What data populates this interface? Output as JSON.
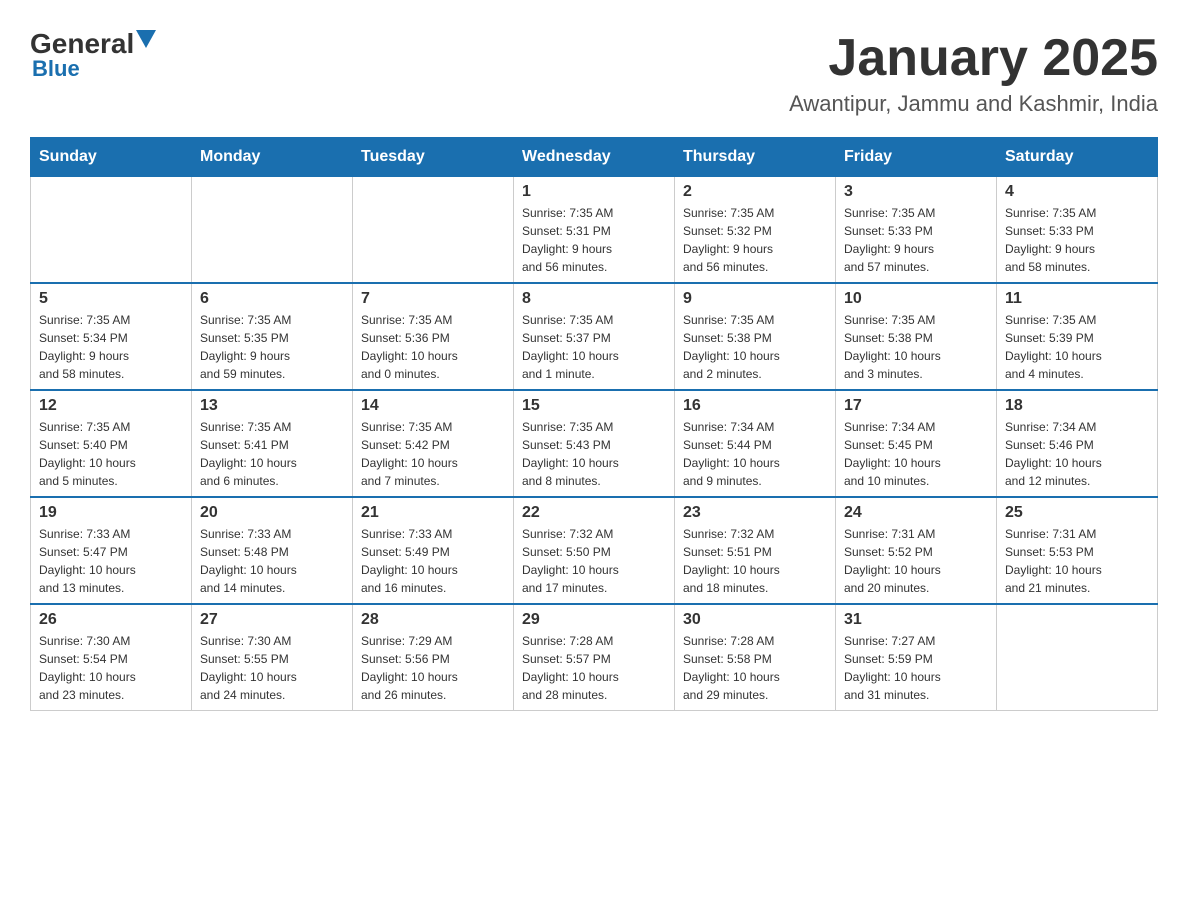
{
  "header": {
    "logo_line1": "General",
    "logo_line2": "Blue",
    "month": "January 2025",
    "location": "Awantipur, Jammu and Kashmir, India"
  },
  "days_of_week": [
    "Sunday",
    "Monday",
    "Tuesday",
    "Wednesday",
    "Thursday",
    "Friday",
    "Saturday"
  ],
  "weeks": [
    [
      {
        "day": "",
        "info": ""
      },
      {
        "day": "",
        "info": ""
      },
      {
        "day": "",
        "info": ""
      },
      {
        "day": "1",
        "info": "Sunrise: 7:35 AM\nSunset: 5:31 PM\nDaylight: 9 hours\nand 56 minutes."
      },
      {
        "day": "2",
        "info": "Sunrise: 7:35 AM\nSunset: 5:32 PM\nDaylight: 9 hours\nand 56 minutes."
      },
      {
        "day": "3",
        "info": "Sunrise: 7:35 AM\nSunset: 5:33 PM\nDaylight: 9 hours\nand 57 minutes."
      },
      {
        "day": "4",
        "info": "Sunrise: 7:35 AM\nSunset: 5:33 PM\nDaylight: 9 hours\nand 58 minutes."
      }
    ],
    [
      {
        "day": "5",
        "info": "Sunrise: 7:35 AM\nSunset: 5:34 PM\nDaylight: 9 hours\nand 58 minutes."
      },
      {
        "day": "6",
        "info": "Sunrise: 7:35 AM\nSunset: 5:35 PM\nDaylight: 9 hours\nand 59 minutes."
      },
      {
        "day": "7",
        "info": "Sunrise: 7:35 AM\nSunset: 5:36 PM\nDaylight: 10 hours\nand 0 minutes."
      },
      {
        "day": "8",
        "info": "Sunrise: 7:35 AM\nSunset: 5:37 PM\nDaylight: 10 hours\nand 1 minute."
      },
      {
        "day": "9",
        "info": "Sunrise: 7:35 AM\nSunset: 5:38 PM\nDaylight: 10 hours\nand 2 minutes."
      },
      {
        "day": "10",
        "info": "Sunrise: 7:35 AM\nSunset: 5:38 PM\nDaylight: 10 hours\nand 3 minutes."
      },
      {
        "day": "11",
        "info": "Sunrise: 7:35 AM\nSunset: 5:39 PM\nDaylight: 10 hours\nand 4 minutes."
      }
    ],
    [
      {
        "day": "12",
        "info": "Sunrise: 7:35 AM\nSunset: 5:40 PM\nDaylight: 10 hours\nand 5 minutes."
      },
      {
        "day": "13",
        "info": "Sunrise: 7:35 AM\nSunset: 5:41 PM\nDaylight: 10 hours\nand 6 minutes."
      },
      {
        "day": "14",
        "info": "Sunrise: 7:35 AM\nSunset: 5:42 PM\nDaylight: 10 hours\nand 7 minutes."
      },
      {
        "day": "15",
        "info": "Sunrise: 7:35 AM\nSunset: 5:43 PM\nDaylight: 10 hours\nand 8 minutes."
      },
      {
        "day": "16",
        "info": "Sunrise: 7:34 AM\nSunset: 5:44 PM\nDaylight: 10 hours\nand 9 minutes."
      },
      {
        "day": "17",
        "info": "Sunrise: 7:34 AM\nSunset: 5:45 PM\nDaylight: 10 hours\nand 10 minutes."
      },
      {
        "day": "18",
        "info": "Sunrise: 7:34 AM\nSunset: 5:46 PM\nDaylight: 10 hours\nand 12 minutes."
      }
    ],
    [
      {
        "day": "19",
        "info": "Sunrise: 7:33 AM\nSunset: 5:47 PM\nDaylight: 10 hours\nand 13 minutes."
      },
      {
        "day": "20",
        "info": "Sunrise: 7:33 AM\nSunset: 5:48 PM\nDaylight: 10 hours\nand 14 minutes."
      },
      {
        "day": "21",
        "info": "Sunrise: 7:33 AM\nSunset: 5:49 PM\nDaylight: 10 hours\nand 16 minutes."
      },
      {
        "day": "22",
        "info": "Sunrise: 7:32 AM\nSunset: 5:50 PM\nDaylight: 10 hours\nand 17 minutes."
      },
      {
        "day": "23",
        "info": "Sunrise: 7:32 AM\nSunset: 5:51 PM\nDaylight: 10 hours\nand 18 minutes."
      },
      {
        "day": "24",
        "info": "Sunrise: 7:31 AM\nSunset: 5:52 PM\nDaylight: 10 hours\nand 20 minutes."
      },
      {
        "day": "25",
        "info": "Sunrise: 7:31 AM\nSunset: 5:53 PM\nDaylight: 10 hours\nand 21 minutes."
      }
    ],
    [
      {
        "day": "26",
        "info": "Sunrise: 7:30 AM\nSunset: 5:54 PM\nDaylight: 10 hours\nand 23 minutes."
      },
      {
        "day": "27",
        "info": "Sunrise: 7:30 AM\nSunset: 5:55 PM\nDaylight: 10 hours\nand 24 minutes."
      },
      {
        "day": "28",
        "info": "Sunrise: 7:29 AM\nSunset: 5:56 PM\nDaylight: 10 hours\nand 26 minutes."
      },
      {
        "day": "29",
        "info": "Sunrise: 7:28 AM\nSunset: 5:57 PM\nDaylight: 10 hours\nand 28 minutes."
      },
      {
        "day": "30",
        "info": "Sunrise: 7:28 AM\nSunset: 5:58 PM\nDaylight: 10 hours\nand 29 minutes."
      },
      {
        "day": "31",
        "info": "Sunrise: 7:27 AM\nSunset: 5:59 PM\nDaylight: 10 hours\nand 31 minutes."
      },
      {
        "day": "",
        "info": ""
      }
    ]
  ]
}
